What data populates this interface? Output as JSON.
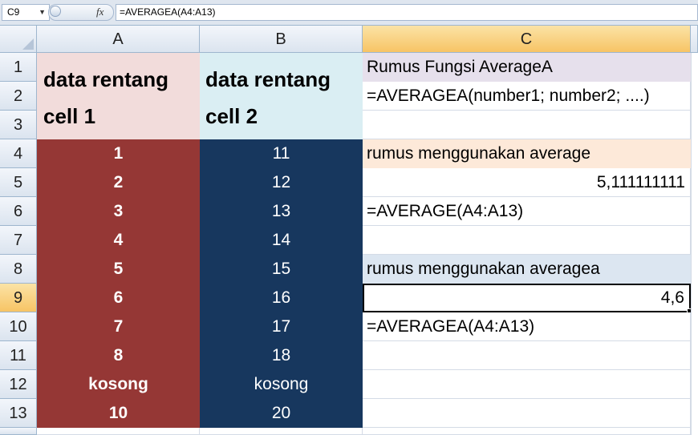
{
  "name_box": "C9",
  "fx_symbol": "fx",
  "formula": "=AVERAGEA(A4:A13)",
  "columns": [
    "A",
    "B",
    "C"
  ],
  "rows": [
    "1",
    "2",
    "3",
    "4",
    "5",
    "6",
    "7",
    "8",
    "9",
    "10",
    "11",
    "12",
    "13"
  ],
  "headers": {
    "a": "data rentang cell 1",
    "b": "data rentang cell 2"
  },
  "col_a": [
    "1",
    "2",
    "3",
    "4",
    "5",
    "6",
    "7",
    "8",
    "kosong",
    "10"
  ],
  "col_b": [
    "11",
    "12",
    "13",
    "14",
    "15",
    "16",
    "17",
    "18",
    "kosong",
    "20"
  ],
  "col_c": {
    "c1": "Rumus Fungsi AverageA",
    "c2": "=AVERAGEA(number1; number2; ....)",
    "c4": "rumus menggunakan average",
    "c5": "5,111111111",
    "c6": "=AVERAGE(A4:A13)",
    "c8": "rumus menggunakan averagea",
    "c9": "4,6",
    "c10": "=AVERAGEA(A4:A13)"
  },
  "colors": {
    "header_a_fill": "#f2dcdb",
    "header_b_fill": "#daeef3",
    "data_a_fill": "#953735",
    "data_b_fill": "#17375e",
    "c1_fill": "#e6e0ec",
    "c4_fill": "#fde9d9",
    "c8_fill": "#dce6f1"
  }
}
